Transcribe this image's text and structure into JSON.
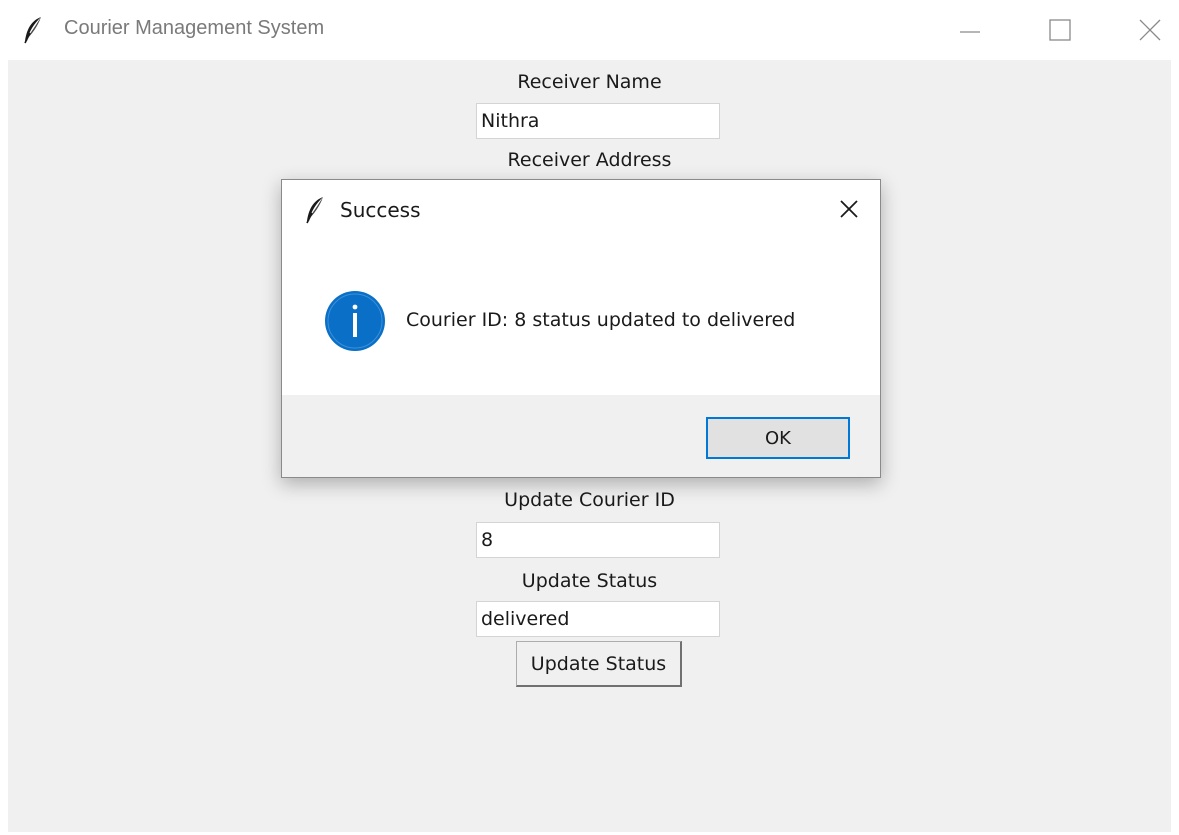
{
  "window": {
    "title": "Courier Management System",
    "icon": "feather-icon",
    "controls": [
      "minimize-icon",
      "maximize-icon",
      "close-icon"
    ]
  },
  "form": {
    "receiver_name_label": "Receiver Name",
    "receiver_name_value": "Nithra",
    "receiver_address_label": "Receiver Address",
    "update_courier_id_label": "Update Courier ID",
    "update_courier_id_value": "8",
    "update_status_label": "Update Status",
    "update_status_value": "delivered",
    "update_status_button": "Update Status"
  },
  "dialog": {
    "title": "Success",
    "icon": "info-icon",
    "message": "Courier ID: 8 status updated to delivered",
    "ok_label": "OK"
  },
  "colors": {
    "info_blue": "#0a6fc7",
    "focus_border": "#0078d7",
    "client_background": "#f0f0f0"
  }
}
